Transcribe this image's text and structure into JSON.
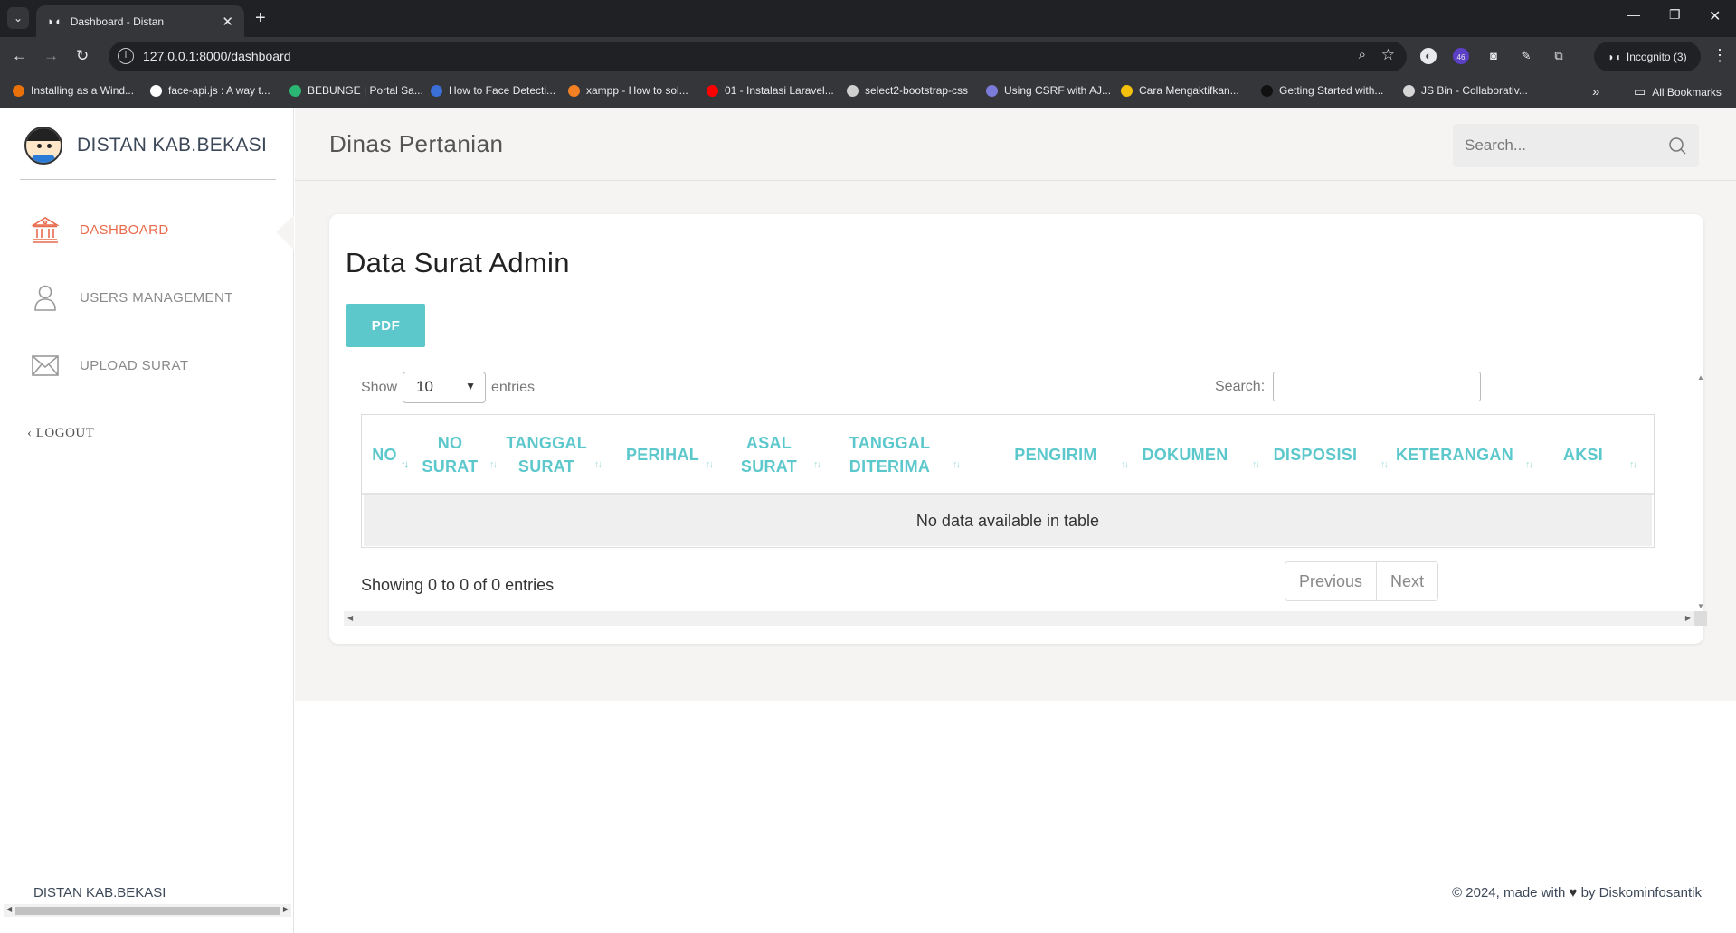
{
  "browser": {
    "tab_title": "Dashboard - Distan",
    "url": "127.0.0.1:8000/dashboard",
    "incognito_label": "Incognito (3)",
    "extension_badge": "46",
    "bookmarks": [
      {
        "label": "Installing as a Wind...",
        "color": "#e8710a"
      },
      {
        "label": "face-api.js : A way t...",
        "color": "#ffffff"
      },
      {
        "label": "BEBUNGE | Portal Sa...",
        "color": "#2bb673"
      },
      {
        "label": "How to Face Detecti...",
        "color": "#3b6fd8"
      },
      {
        "label": "xampp - How to sol...",
        "color": "#f48024"
      },
      {
        "label": "01 - Instalasi Laravel...",
        "color": "#ff0000"
      },
      {
        "label": "select2-bootstrap-css",
        "color": "#cfcfcf"
      },
      {
        "label": "Using CSRF with AJ...",
        "color": "#7a7ad8"
      },
      {
        "label": "Cara Mengaktifkan...",
        "color": "#f4c20d"
      },
      {
        "label": "Getting Started with...",
        "color": "#111111"
      },
      {
        "label": "JS Bin - Collaborativ...",
        "color": "#d6d6d6"
      }
    ],
    "all_bookmarks_label": "All Bookmarks"
  },
  "sidebar": {
    "brand": "DISTAN KAB.BEKASI",
    "items": [
      {
        "label": "DASHBOARD",
        "icon": "bank-icon",
        "active": true
      },
      {
        "label": "USERS MANAGEMENT",
        "icon": "user-icon",
        "active": false
      },
      {
        "label": "UPLOAD SURAT",
        "icon": "envelope-icon",
        "active": false
      }
    ],
    "logout_label": "LOGOUT",
    "footer": "DISTAN KAB.BEKASI"
  },
  "header": {
    "title": "Dinas Pertanian",
    "search_placeholder": "Search..."
  },
  "card": {
    "title": "Data Surat Admin",
    "pdf_label": "PDF"
  },
  "table": {
    "show_label": "Show",
    "entries_value": "10",
    "entries_label": "entries",
    "search_label": "Search:",
    "columns": [
      {
        "label": "NO"
      },
      {
        "label": "NO SURAT"
      },
      {
        "label": "TANGGAL SURAT"
      },
      {
        "label": "PERIHAL"
      },
      {
        "label": "ASAL SURAT"
      },
      {
        "label": "TANGGAL DITERIMA"
      },
      {
        "label": "PENGIRIM"
      },
      {
        "label": "DOKUMEN"
      },
      {
        "label": "DISPOSISI"
      },
      {
        "label": "KETERANGAN"
      },
      {
        "label": "AKSI"
      }
    ],
    "sorted_column": "NO",
    "empty_message": "No data available in table",
    "info": "Showing 0 to 0 of 0 entries",
    "prev_label": "Previous",
    "next_label": "Next"
  },
  "footer": {
    "prefix": "© 2024, made with",
    "suffix": "by Diskominfosantik"
  },
  "colors": {
    "accent": "#5cc8cc",
    "active_nav": "#e86a4c"
  }
}
